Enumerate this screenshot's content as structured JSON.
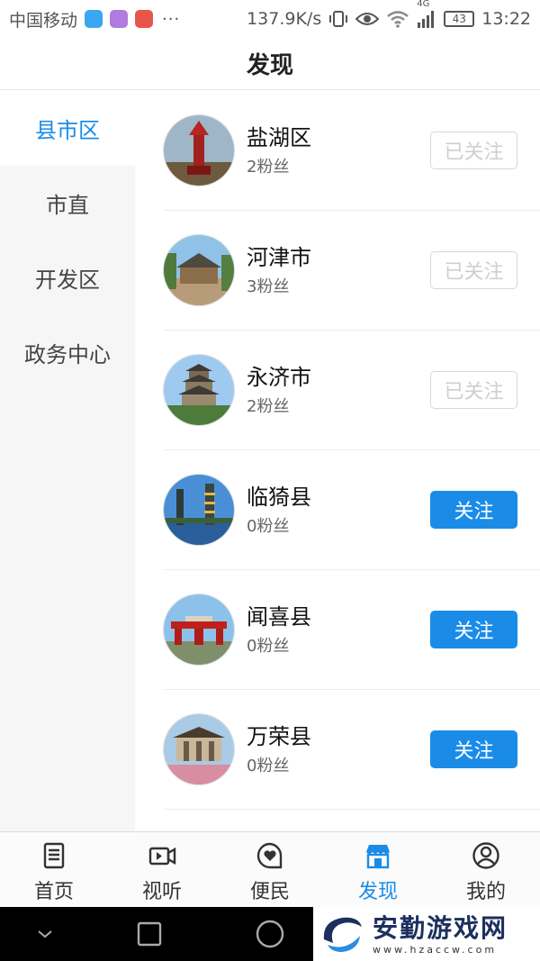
{
  "status_bar": {
    "carrier": "中国移动",
    "net_speed": "137.9K/s",
    "network_type": "4G",
    "battery": "43",
    "time": "13:22",
    "dots": "···"
  },
  "header": {
    "title": "发现"
  },
  "sidebar": {
    "items": [
      {
        "label": "县市区",
        "active": true
      },
      {
        "label": "市直",
        "active": false
      },
      {
        "label": "开发区",
        "active": false
      },
      {
        "label": "政务中心",
        "active": false
      }
    ]
  },
  "accounts": [
    {
      "name": "盐湖区",
      "fans": "2粉丝",
      "button": "已关注",
      "followed": true
    },
    {
      "name": "河津市",
      "fans": "3粉丝",
      "button": "已关注",
      "followed": true
    },
    {
      "name": "永济市",
      "fans": "2粉丝",
      "button": "已关注",
      "followed": true
    },
    {
      "name": "临猗县",
      "fans": "0粉丝",
      "button": "关注",
      "followed": false
    },
    {
      "name": "闻喜县",
      "fans": "0粉丝",
      "button": "关注",
      "followed": false
    },
    {
      "name": "万荣县",
      "fans": "0粉丝",
      "button": "关注",
      "followed": false
    }
  ],
  "tabbar": {
    "items": [
      {
        "label": "首页",
        "icon": "document-icon"
      },
      {
        "label": "视听",
        "icon": "video-icon"
      },
      {
        "label": "便民",
        "icon": "heart-chat-icon"
      },
      {
        "label": "发现",
        "icon": "store-icon",
        "active": true
      },
      {
        "label": "我的",
        "icon": "user-icon"
      }
    ]
  },
  "watermark": {
    "text": "安勤游戏网",
    "url": "www.hzaccw.com"
  },
  "colors": {
    "accent": "#1a8ce8",
    "followed_text": "#cfcfcf"
  }
}
